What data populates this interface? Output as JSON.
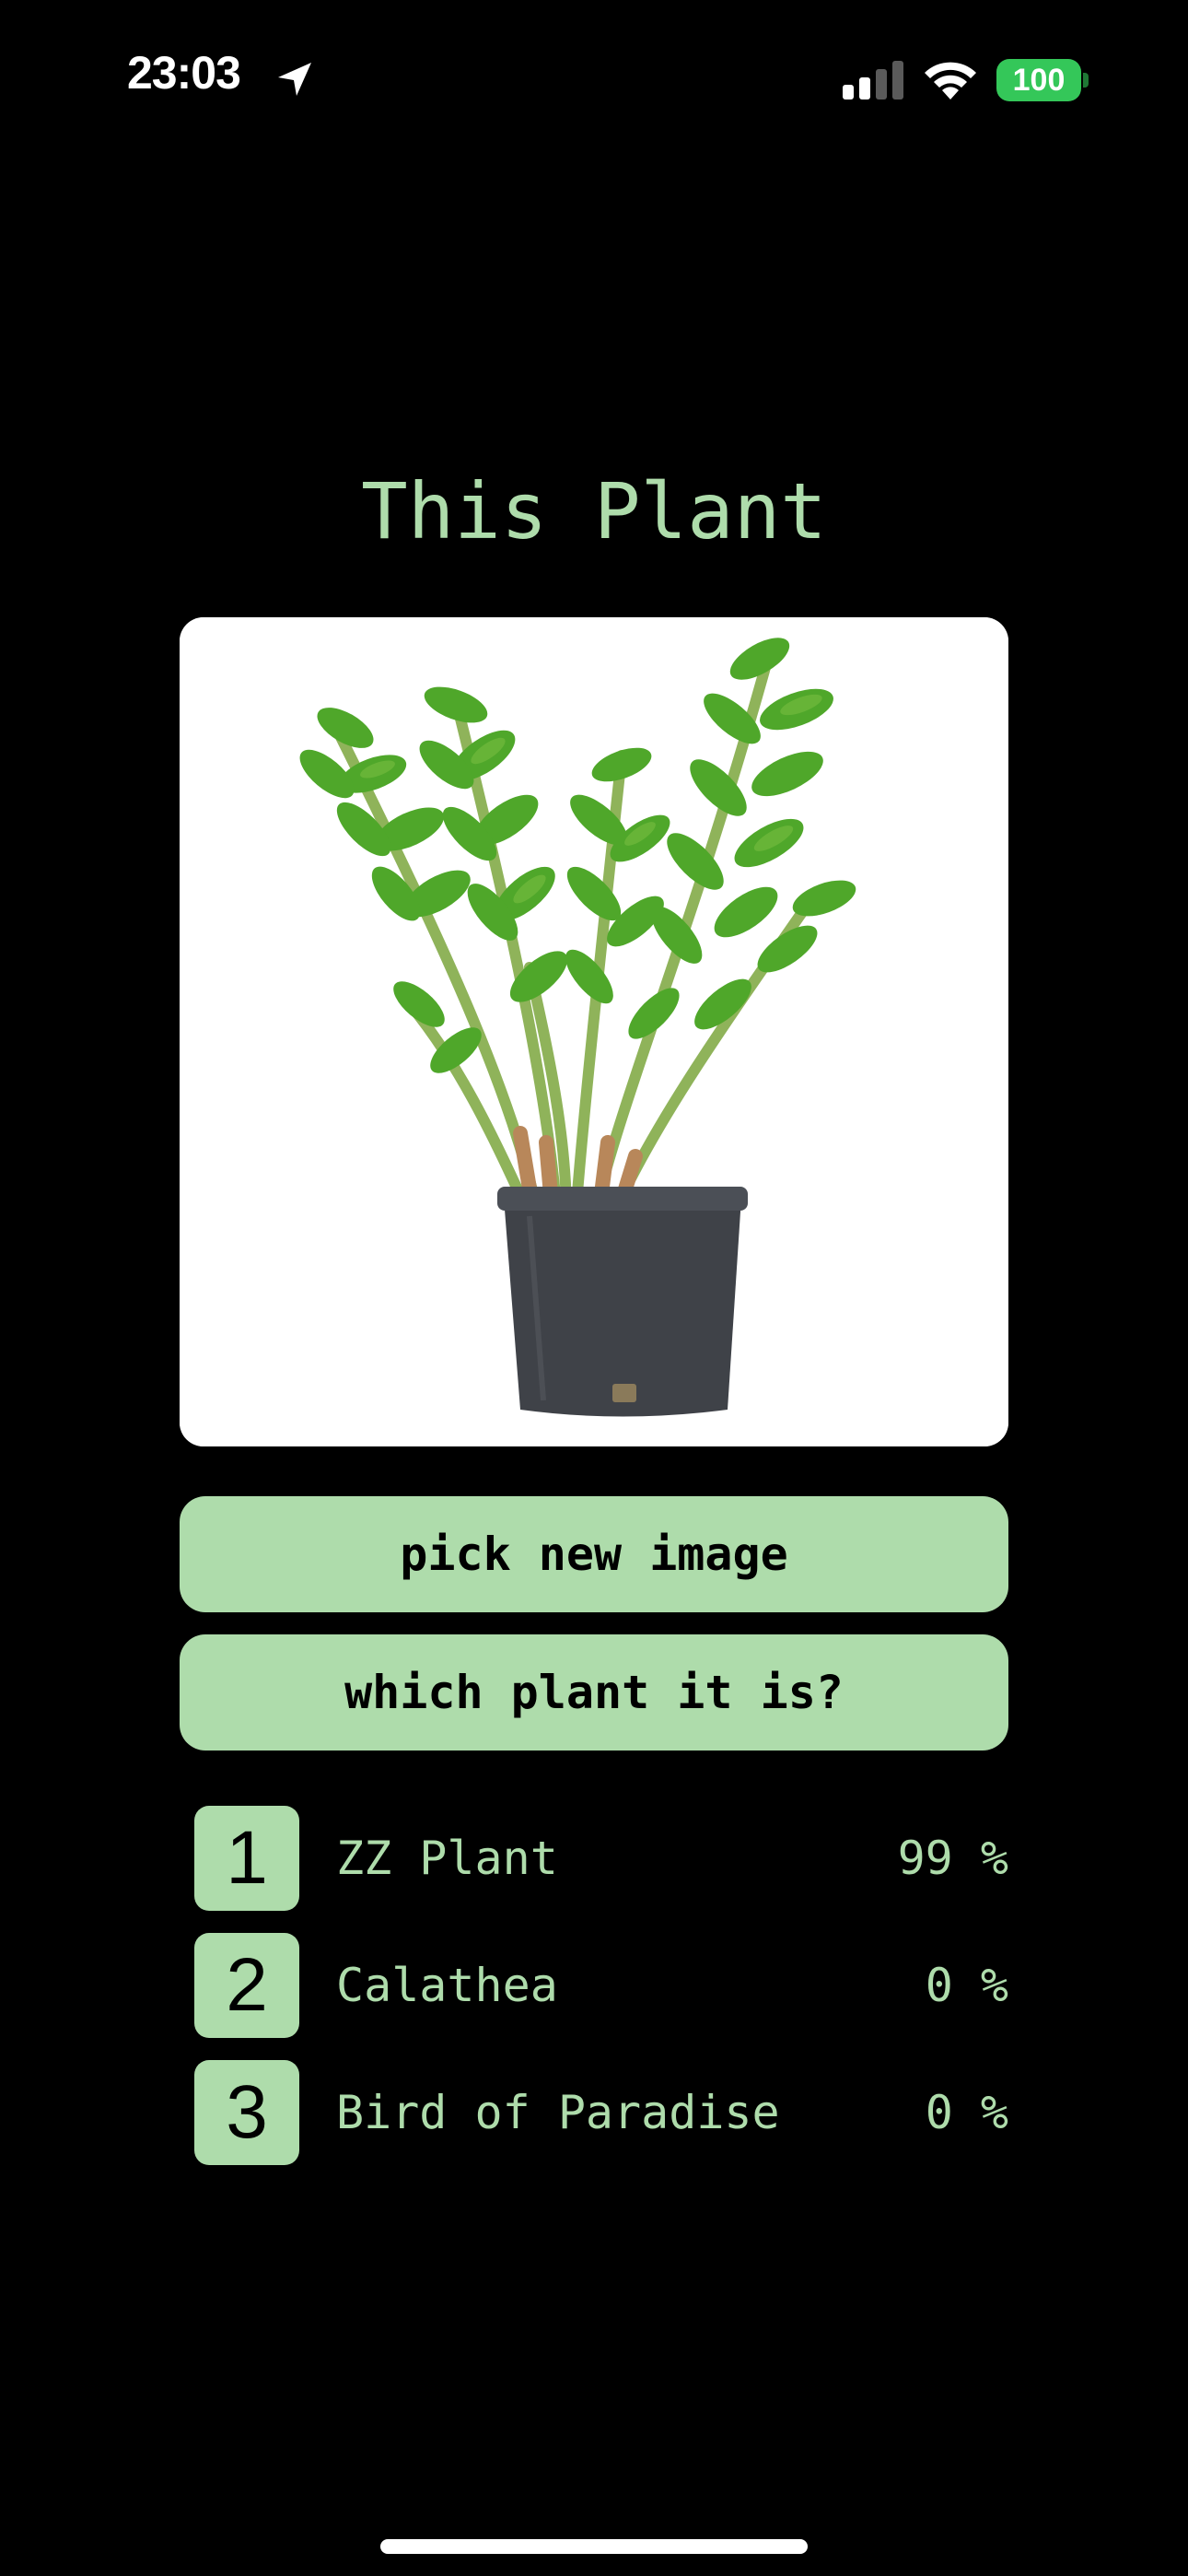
{
  "status_bar": {
    "time": "23:03",
    "battery": "100",
    "icons": [
      "location-arrow-icon",
      "cellular-signal-icon",
      "wifi-icon",
      "battery-icon"
    ]
  },
  "main": {
    "title": "This Plant",
    "image": {
      "subject": "potted-zz-plant"
    },
    "buttons": {
      "pick_label": "pick new image",
      "identify_label": "which plant it is?"
    },
    "results": [
      {
        "rank": "1",
        "name": "ZZ Plant",
        "percent": "99 %"
      },
      {
        "rank": "2",
        "name": "Calathea",
        "percent": "0 %"
      },
      {
        "rank": "3",
        "name": "Bird of Paradise",
        "percent": "0 %"
      }
    ]
  },
  "colors": {
    "background": "#000000",
    "accent": "#aedcab",
    "battery": "#34c759",
    "text_on_accent": "#000000"
  }
}
